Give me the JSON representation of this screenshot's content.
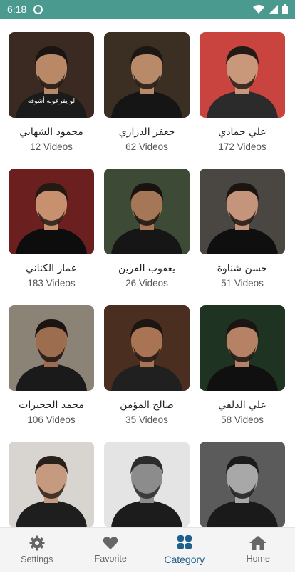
{
  "status": {
    "time": "6:18"
  },
  "reciters": [
    {
      "name": "محمود الشهابي",
      "count": "12 Videos",
      "caption": "لو يفرعونه أشوفه",
      "bg": "#3a2a22",
      "skin": "#b88867",
      "hair": "#1a1412",
      "shirt": "#1b1b1b"
    },
    {
      "name": "جعفر الدرازي",
      "count": "62 Videos",
      "bg": "#3b2e23",
      "skin": "#b88a68",
      "hair": "#1d1714",
      "shirt": "#151515"
    },
    {
      "name": "علي حمادي",
      "count": "172 Videos",
      "bg": "#c9443f",
      "skin": "#c99779",
      "hair": "#231a16",
      "shirt": "#2b2b2b"
    },
    {
      "name": "عمار الكناني",
      "count": "183 Videos",
      "bg": "#6b1f1f",
      "skin": "#c79170",
      "hair": "#241a14",
      "shirt": "#0d0d0d"
    },
    {
      "name": "يعقوب القرين",
      "count": "26 Videos",
      "bg": "#3c4a36",
      "skin": "#a67756",
      "hair": "#181210",
      "shirt": "#161616"
    },
    {
      "name": "حسن شناوة",
      "count": "51 Videos",
      "bg": "#4a4642",
      "skin": "#c4957a",
      "hair": "#1b1512",
      "shirt": "#0f0f0f"
    },
    {
      "name": "محمد الحجيرات",
      "count": "106 Videos",
      "bg": "#8a8376",
      "skin": "#9c6e4f",
      "hair": "#1b1412",
      "shirt": "#1a1a1a"
    },
    {
      "name": "صالح المؤمن",
      "count": "35 Videos",
      "bg": "#4a2e20",
      "skin": "#a87454",
      "hair": "#1c1512",
      "shirt": "#202020"
    },
    {
      "name": "علي الدلفي",
      "count": "58 Videos",
      "bg": "#1e3322",
      "skin": "#b58265",
      "hair": "#1a1412",
      "shirt": "#101010"
    },
    {
      "name": "",
      "count": "",
      "bg": "#d8d4cf",
      "skin": "#c69a7e",
      "hair": "#2a201a",
      "shirt": "#1e1e1e"
    },
    {
      "name": "",
      "count": "",
      "bg": "#e4e4e4",
      "skin": "#8c8c8c",
      "hair": "#2b2b2b",
      "shirt": "#1c1c1c"
    },
    {
      "name": "",
      "count": "",
      "bg": "#5b5b5b",
      "skin": "#a8a8a8",
      "hair": "#1b1b1b",
      "shirt": "#1a1a1a"
    }
  ],
  "nav": {
    "settings": "Settings",
    "favorite": "Favorite",
    "category": "Category",
    "home": "Home",
    "active_color": "#1f5f8b",
    "inactive_color": "#666666"
  }
}
